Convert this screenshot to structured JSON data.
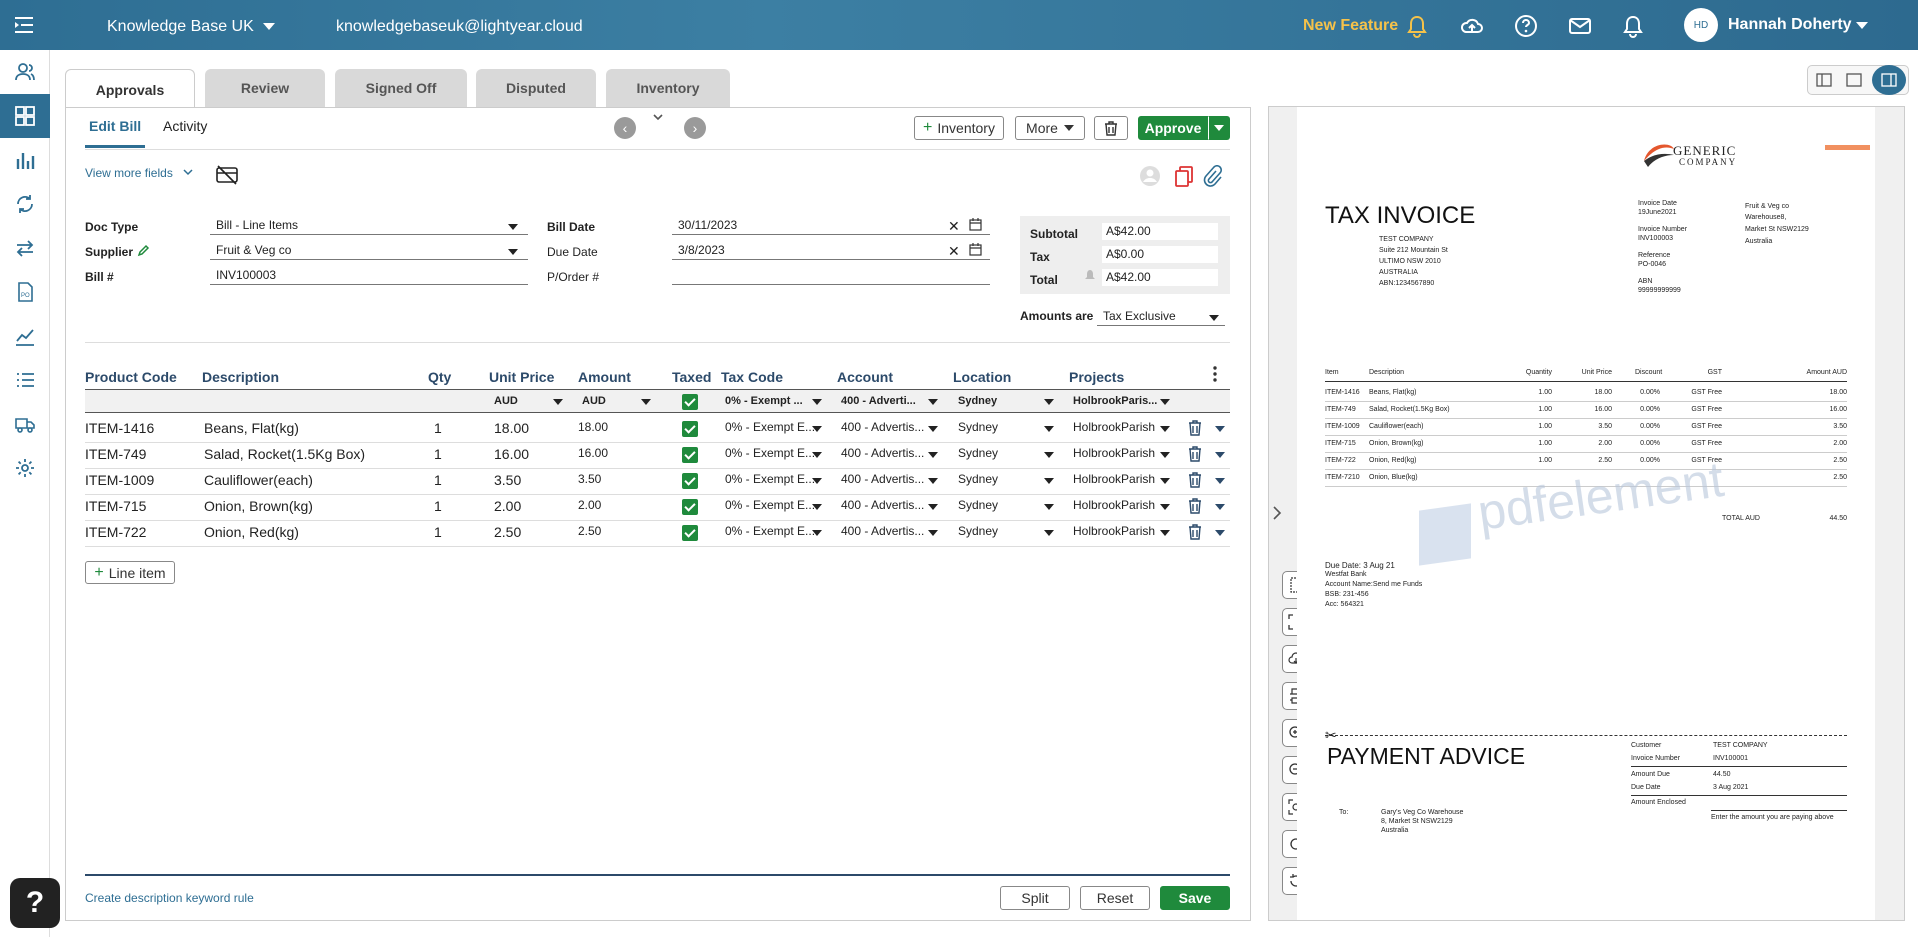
{
  "topbar": {
    "org_name": "Knowledge Base UK",
    "email": "knowledgebaseuk@lightyear.cloud",
    "new_feature": "New Feature",
    "avatar_initials": "HD",
    "user_name": "Hannah Doherty"
  },
  "tabs": [
    "Approvals",
    "Review",
    "Signed Off",
    "Disputed",
    "Inventory"
  ],
  "subtabs": {
    "edit_bill": "Edit Bill",
    "activity": "Activity"
  },
  "toolbar": {
    "inventory": "Inventory",
    "more": "More",
    "approve": "Approve"
  },
  "view_more": "View more fields",
  "form": {
    "doc_type_label": "Doc Type",
    "doc_type": "Bill - Line Items",
    "supplier_label": "Supplier",
    "supplier": "Fruit & Veg co",
    "bill_no_label": "Bill #",
    "bill_no": "INV100003",
    "bill_date_label": "Bill Date",
    "bill_date": "30/11/2023",
    "due_date_label": "Due Date",
    "due_date": "3/8/2023",
    "porder_label": "P/Order #",
    "porder": ""
  },
  "totals": {
    "subtotal_label": "Subtotal",
    "subtotal": "A$42.00",
    "tax_label": "Tax",
    "tax": "A$0.00",
    "total_label": "Total",
    "total": "A$42.00",
    "amounts_are_label": "Amounts are",
    "amounts_are": "Tax Exclusive"
  },
  "table": {
    "headers": {
      "product_code": "Product Code",
      "description": "Description",
      "qty": "Qty",
      "unit_price": "Unit Price",
      "amount": "Amount",
      "taxed": "Taxed",
      "tax_code": "Tax Code",
      "account": "Account",
      "location": "Location",
      "projects": "Projects"
    },
    "defaults": {
      "unit_price_currency": "AUD",
      "amount_currency": "AUD",
      "tax_code": "0% - Exempt ...",
      "account": "400 - Adverti...",
      "location": "Sydney",
      "projects": "HolbrookParis..."
    },
    "rows": [
      {
        "code": "ITEM-1416",
        "desc": "Beans, Flat(kg)",
        "qty": "1",
        "unit": "18.00",
        "amount": "18.00",
        "tax_code": "0% - Exempt E...",
        "account": "400 - Advertis...",
        "location": "Sydney",
        "project": "HolbrookParish"
      },
      {
        "code": "ITEM-749",
        "desc": "Salad, Rocket(1.5Kg Box)",
        "qty": "1",
        "unit": "16.00",
        "amount": "16.00",
        "tax_code": "0% - Exempt E...",
        "account": "400 - Advertis...",
        "location": "Sydney",
        "project": "HolbrookParish"
      },
      {
        "code": "ITEM-1009",
        "desc": "Cauliflower(each)",
        "qty": "1",
        "unit": "3.50",
        "amount": "3.50",
        "tax_code": "0% - Exempt E...",
        "account": "400 - Advertis...",
        "location": "Sydney",
        "project": "HolbrookParish"
      },
      {
        "code": "ITEM-715",
        "desc": "Onion, Brown(kg)",
        "qty": "1",
        "unit": "2.00",
        "amount": "2.00",
        "tax_code": "0% - Exempt E...",
        "account": "400 - Advertis...",
        "location": "Sydney",
        "project": "HolbrookParish"
      },
      {
        "code": "ITEM-722",
        "desc": "Onion, Red(kg)",
        "qty": "1",
        "unit": "2.50",
        "amount": "2.50",
        "tax_code": "0% - Exempt E...",
        "account": "400 - Advertis...",
        "location": "Sydney",
        "project": "HolbrookParish"
      }
    ],
    "add_line": "Line item"
  },
  "footer": {
    "keyword_rule": "Create description keyword rule",
    "split": "Split",
    "reset": "Reset",
    "save": "Save"
  },
  "pdf": {
    "logo_line1": "GENERIC",
    "logo_line2": "COMPANY",
    "title": "TAX INVOICE",
    "company": [
      "TEST COMPANY",
      "Suite 212 Mountain St",
      "ULTIMO NSW 2010",
      "AUSTRALIA",
      "ABN:1234567890"
    ],
    "invoice_date_label": "Invoice Date",
    "invoice_date": "19June2021",
    "invoice_number_label": "Invoice Number",
    "invoice_number": "INV100003",
    "reference_label": "Reference",
    "reference": "PO-0046",
    "abn_label": "ABN",
    "abn": "99999999999",
    "supplier_addr": [
      "Fruit & Veg co",
      "Warehouse8,",
      "Market St NSW2129",
      "Australia"
    ],
    "headers": [
      "Item",
      "Description",
      "Quantity",
      "Unit Price",
      "Discount",
      "GST",
      "Amount AUD"
    ],
    "rows": [
      [
        "ITEM-1416",
        "Beans, Flat(kg)",
        "1.00",
        "18.00",
        "0.00%",
        "GST Free",
        "18.00"
      ],
      [
        "ITEM-749",
        "Salad, Rocket(1.5Kg Box)",
        "1.00",
        "16.00",
        "0.00%",
        "GST Free",
        "16.00"
      ],
      [
        "ITEM-1009",
        "Cauliflower(each)",
        "1.00",
        "3.50",
        "0.00%",
        "GST Free",
        "3.50"
      ],
      [
        "ITEM-715",
        "Onion, Brown(kg)",
        "1.00",
        "2.00",
        "0.00%",
        "GST Free",
        "2.00"
      ],
      [
        "ITEM-722",
        "Onion, Red(kg)",
        "1.00",
        "2.50",
        "0.00%",
        "GST Free",
        "2.50"
      ],
      [
        "ITEM-7210",
        "Onion, Blue(kg)",
        "",
        "",
        "",
        "",
        "2.50"
      ]
    ],
    "total_label": "TOTAL AUD",
    "total": "44.50",
    "watermark": "pdfelement",
    "due_date": "Due Date: 3 Aug 21",
    "bank": [
      "Westfat Bank",
      "Account Name:Send me Funds",
      "BSB: 231-456",
      "Acc: 564321"
    ],
    "payment_advice": "PAYMENT ADVICE",
    "pa_to_label": "To:",
    "pa_to": [
      "Gary's Veg Co Warehouse",
      "8, Market St NSW2129",
      "Australia"
    ],
    "pa_customer_label": "Customer",
    "pa_customer": "TEST COMPANY",
    "pa_invoice_label": "Invoice Number",
    "pa_invoice": "INV100001",
    "pa_amount_due_label": "Amount Due",
    "pa_amount_due": "44.50",
    "pa_due_date_label": "Due Date",
    "pa_due_date": "3 Aug 2021",
    "pa_enclosed_label": "Amount Enclosed",
    "pa_enclosed_hint": "Enter the amount you are paying above"
  },
  "colors": {
    "brand": "#2e6e93",
    "approve": "#1f8a3c",
    "new_feature": "#f5c24a"
  }
}
